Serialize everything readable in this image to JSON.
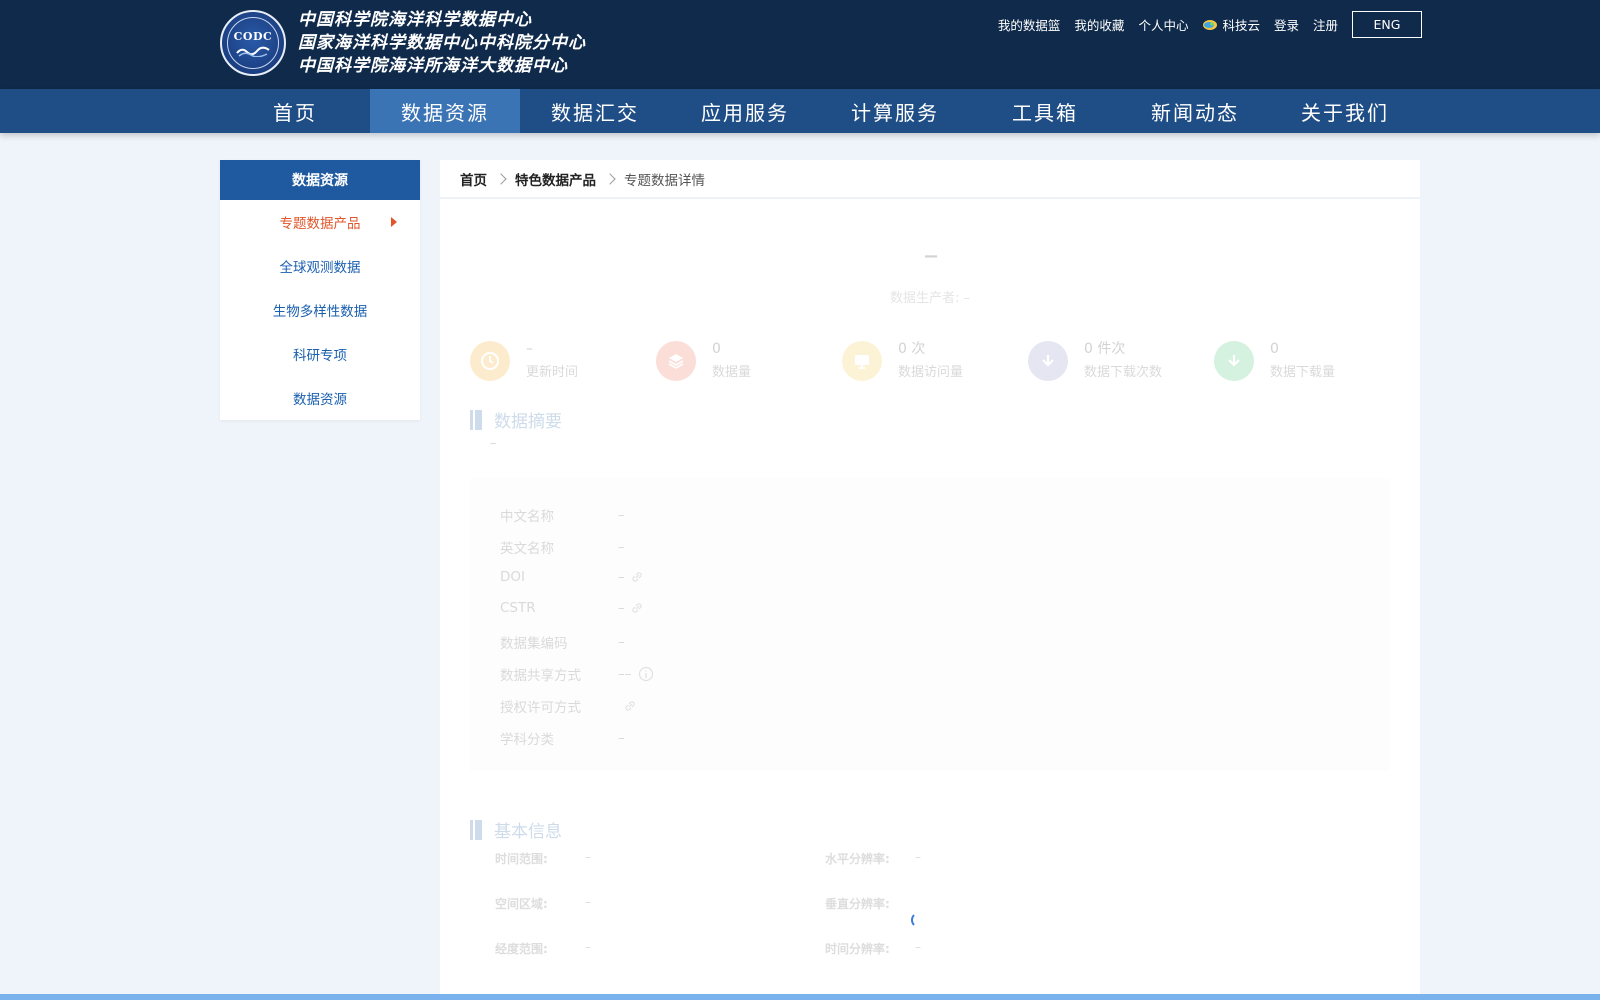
{
  "header": {
    "logo_text": "CODC",
    "org_names": [
      "中国科学院海洋科学数据中心",
      "国家海洋科学数据中心中科院分中心",
      "中国科学院海洋所海洋大数据中心"
    ],
    "top_links": [
      "我的数据篮",
      "我的收藏",
      "个人中心",
      "科技云",
      "登录",
      "注册"
    ],
    "lang_button": "ENG"
  },
  "nav": {
    "items": [
      "首页",
      "数据资源",
      "数据汇交",
      "应用服务",
      "计算服务",
      "工具箱",
      "新闻动态",
      "关于我们"
    ],
    "active_index": 1
  },
  "sidebar": {
    "title": "数据资源",
    "items": [
      "专题数据产品",
      "全球观测数据",
      "生物多样性数据",
      "科研专项",
      "数据资源"
    ],
    "active_index": 0
  },
  "breadcrumb": {
    "items": [
      "首页",
      "特色数据产品",
      "专题数据详情"
    ]
  },
  "detail": {
    "title": "–",
    "producer_label": "数据生产者:",
    "producer_value": "–",
    "stats": [
      {
        "value": "–",
        "label": "更新时间",
        "icon": "clock-icon",
        "color": "#f5a623"
      },
      {
        "value": "0",
        "label": "数据量",
        "icon": "layers-icon",
        "color": "#ea6a48"
      },
      {
        "value": "0 次",
        "label": "数据访问量",
        "icon": "monitor-icon",
        "color": "#f2c744"
      },
      {
        "value": "0 件次",
        "label": "数据下载次数",
        "icon": "download-icon",
        "color": "#8a8fbf"
      },
      {
        "value": "0",
        "label": "数据下载量",
        "icon": "download-icon",
        "color": "#3fbf6f"
      }
    ],
    "abstract_title": "数据摘要",
    "abstract_text": "–",
    "fields": [
      {
        "key": "中文名称",
        "value": "–",
        "link": false,
        "info": false
      },
      {
        "key": "英文名称",
        "value": "–",
        "link": false,
        "info": false
      },
      {
        "key": "DOI",
        "value": "–",
        "link": true,
        "info": false
      },
      {
        "key": "CSTR",
        "value": "–",
        "link": true,
        "info": false
      },
      {
        "key": "数据集编码",
        "value": "–",
        "link": false,
        "info": false
      },
      {
        "key": "数据共享方式",
        "value": "––",
        "link": false,
        "info": true
      },
      {
        "key": "授权许可方式",
        "value": "",
        "link": true,
        "info": false
      },
      {
        "key": "学科分类",
        "value": "–",
        "link": false,
        "info": false
      }
    ],
    "basic_title": "基本信息",
    "basic_info": [
      {
        "key": "时间范围:",
        "value": "–"
      },
      {
        "key": "水平分辨率:",
        "value": "–"
      },
      {
        "key": "空间区域:",
        "value": "–"
      },
      {
        "key": "垂直分辨率:",
        "value": ""
      },
      {
        "key": "经度范围:",
        "value": "–"
      },
      {
        "key": "时间分辨率:",
        "value": "–"
      }
    ]
  },
  "colors": {
    "header_bg": "#0f2a4a",
    "nav_bg": "#1f4e86",
    "nav_active": "#3b74b5",
    "sidebar_head": "#1f5aa0",
    "sidebar_active_text": "#e0562a",
    "link_blue": "#1a5fb0"
  }
}
